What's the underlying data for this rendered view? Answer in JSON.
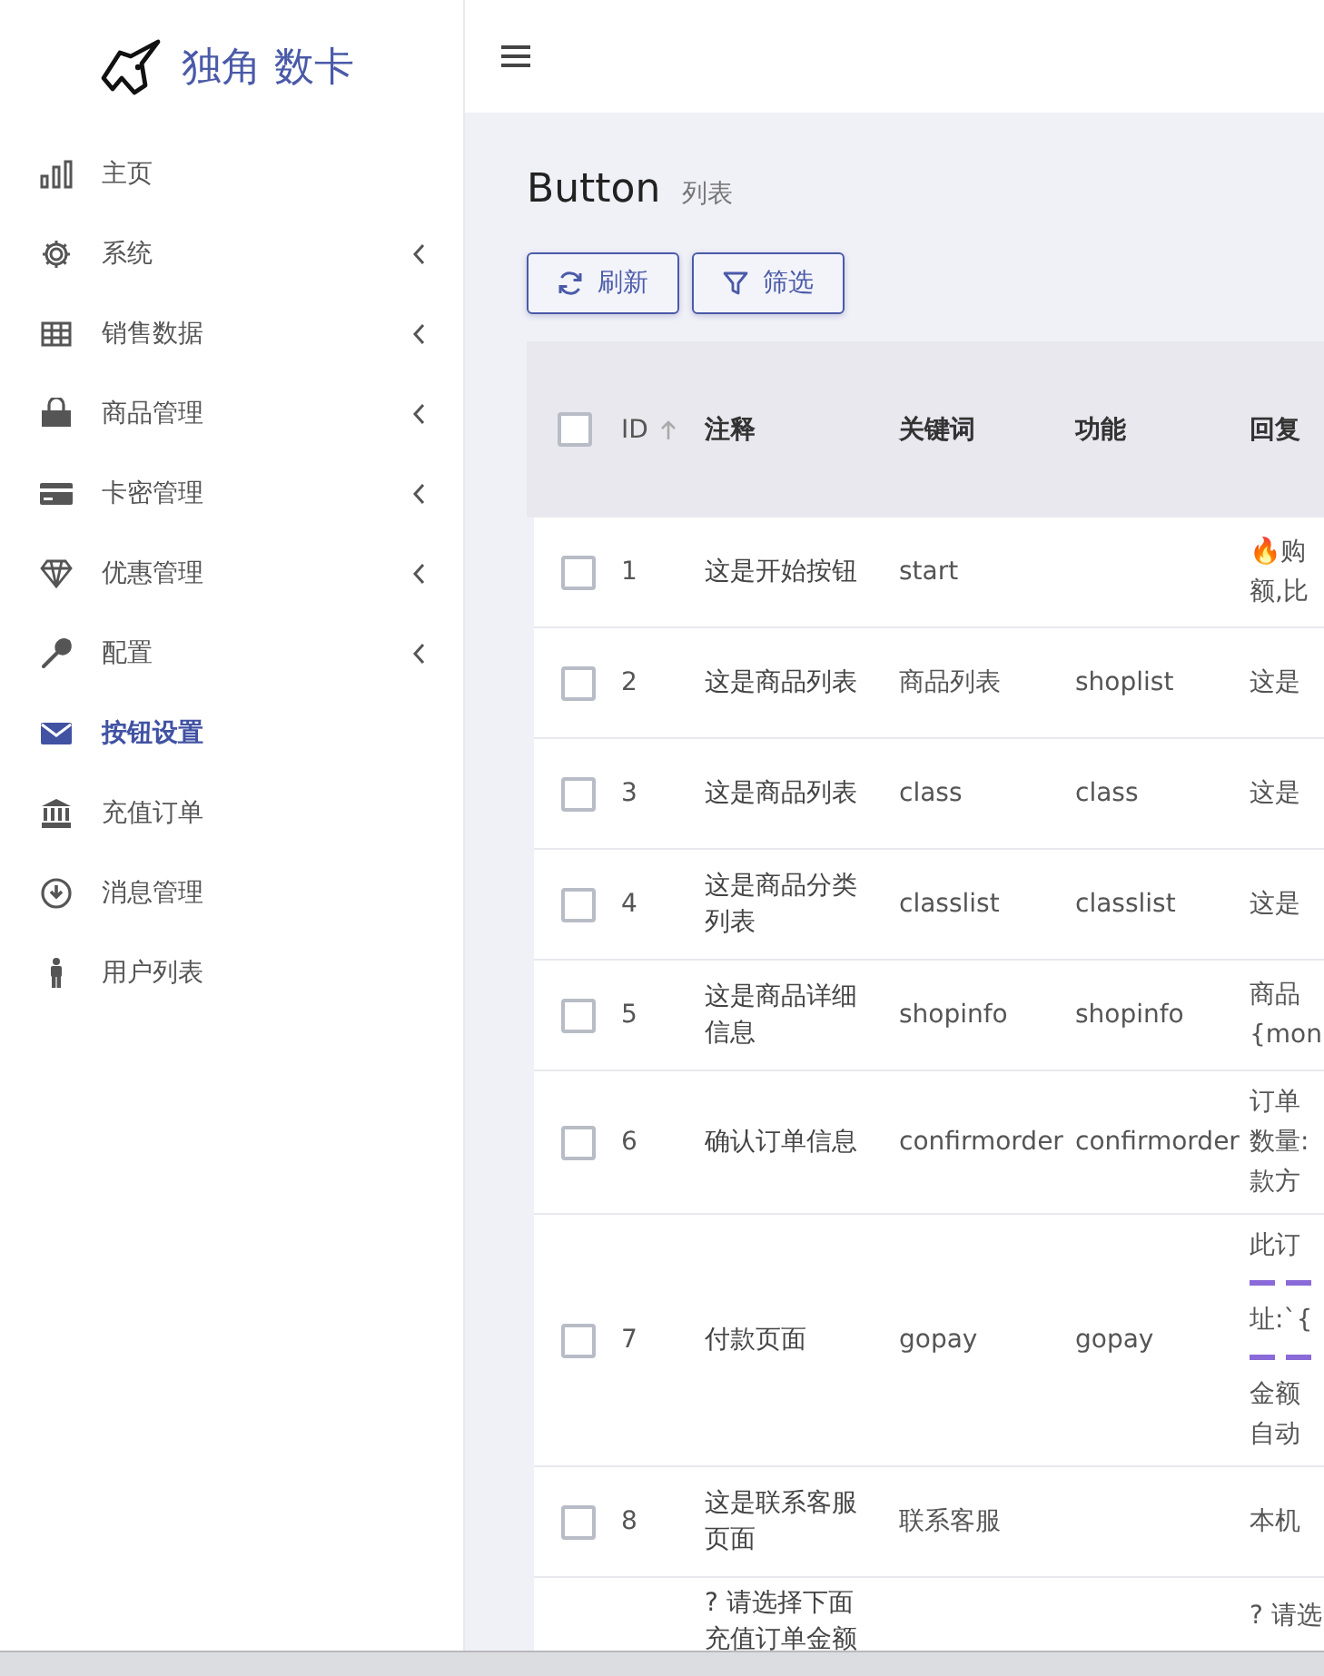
{
  "brand": {
    "name": "独角 数卡"
  },
  "sidebar": {
    "items": [
      {
        "label": "主页",
        "has_submenu": false,
        "selected": false
      },
      {
        "label": "系统",
        "has_submenu": true,
        "selected": false
      },
      {
        "label": "销售数据",
        "has_submenu": true,
        "selected": false
      },
      {
        "label": "商品管理",
        "has_submenu": true,
        "selected": false
      },
      {
        "label": "卡密管理",
        "has_submenu": true,
        "selected": false
      },
      {
        "label": "优惠管理",
        "has_submenu": true,
        "selected": false
      },
      {
        "label": "配置",
        "has_submenu": true,
        "selected": false
      },
      {
        "label": "按钮设置",
        "has_submenu": false,
        "selected": true
      },
      {
        "label": "充值订单",
        "has_submenu": false,
        "selected": false
      },
      {
        "label": "消息管理",
        "has_submenu": false,
        "selected": false
      },
      {
        "label": "用户列表",
        "has_submenu": false,
        "selected": false
      }
    ]
  },
  "page": {
    "title": "Button",
    "subtitle": "列表"
  },
  "toolbar": [
    {
      "label": "刷新"
    },
    {
      "label": "筛选"
    }
  ],
  "table": {
    "select_all": {
      "checked": false
    },
    "columns": [
      "ID",
      "注释",
      "关键词",
      "功能",
      "回复"
    ],
    "rows": [
      {
        "checked": false,
        "id": "1",
        "note": "这是开始按钮",
        "keyword": "start",
        "reply": [
          {
            "kind": "text",
            "text": "🔥购"
          },
          {
            "kind": "text",
            "text": "额,比"
          }
        ]
      },
      {
        "checked": false,
        "id": "2",
        "note": "这是商品列表",
        "keyword": "商品列表",
        "function": "shoplist",
        "reply": [
          {
            "kind": "text",
            "text": "这是"
          }
        ]
      },
      {
        "checked": false,
        "id": "3",
        "note": "这是商品列表",
        "keyword": "class",
        "function": "class",
        "reply": [
          {
            "kind": "text",
            "text": "这是"
          }
        ]
      },
      {
        "checked": false,
        "id": "4",
        "note": "这是商品分类列表",
        "keyword": "classlist",
        "function": "classlist",
        "reply": [
          {
            "kind": "text",
            "text": "这是"
          }
        ]
      },
      {
        "checked": false,
        "id": "5",
        "note": "这是商品详细信息",
        "keyword": "shopinfo",
        "function": "shopinfo",
        "reply": [
          {
            "kind": "text",
            "text": "商品"
          },
          {
            "kind": "text",
            "text": "{mon"
          }
        ]
      },
      {
        "checked": false,
        "id": "6",
        "note": "确认订单信息",
        "keyword": "confirmorder",
        "function": "confirmorder",
        "reply": [
          {
            "kind": "text",
            "text": "订单"
          },
          {
            "kind": "text",
            "text": "数量:"
          },
          {
            "kind": "text",
            "text": "款方"
          }
        ]
      },
      {
        "checked": false,
        "id": "7",
        "note": "付款页面",
        "keyword": "gopay",
        "function": "gopay",
        "reply": [
          {
            "kind": "text",
            "text": "此订"
          },
          {
            "kind": "rule"
          },
          {
            "kind": "text",
            "text": "址:`{"
          },
          {
            "kind": "rule"
          },
          {
            "kind": "text",
            "text": "金额"
          },
          {
            "kind": "text",
            "text": "自动"
          }
        ]
      },
      {
        "checked": false,
        "id": "8",
        "note": "这是联系客服页面",
        "keyword": "联系客服",
        "reply": [
          {
            "kind": "text",
            "text": "本机"
          }
        ]
      },
      {
        "note": "? 请选择下面充值订单金额",
        "reply": [
          {
            "kind": "text",
            "text": "? 请选"
          }
        ]
      }
    ]
  }
}
